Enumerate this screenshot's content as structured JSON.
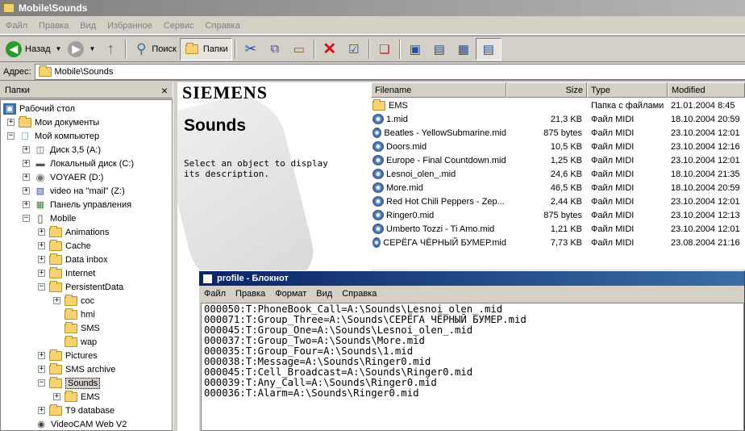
{
  "window": {
    "title": "Mobile\\Sounds"
  },
  "menu": [
    "Файл",
    "Правка",
    "Вид",
    "Избранное",
    "Сервис",
    "Справка"
  ],
  "toolbar": {
    "back_label": "Назад",
    "search_label": "Поиск",
    "folders_label": "Папки"
  },
  "address": {
    "label": "Адрес:",
    "value": "Mobile\\Sounds"
  },
  "folders_pane": {
    "title": "Папки",
    "close": "×",
    "tree": [
      {
        "label": "Рабочий стол"
      },
      {
        "label": "Мои документы"
      },
      {
        "label": "Мой компьютер"
      },
      {
        "label": "Диск 3,5 (A:)"
      },
      {
        "label": "Локальный диск (C:)"
      },
      {
        "label": "VOYAER (D:)"
      },
      {
        "label": "video на \"mail\" (Z:)"
      },
      {
        "label": "Панель управления"
      },
      {
        "label": "Mobile"
      },
      {
        "label": "Animations"
      },
      {
        "label": "Cache"
      },
      {
        "label": "Data inbox"
      },
      {
        "label": "Internet"
      },
      {
        "label": "PersistentData"
      },
      {
        "label": "coc"
      },
      {
        "label": "hmi"
      },
      {
        "label": "SMS"
      },
      {
        "label": "wap"
      },
      {
        "label": "Pictures"
      },
      {
        "label": "SMS archive"
      },
      {
        "label": "Sounds"
      },
      {
        "label": "EMS"
      },
      {
        "label": "T9 database"
      },
      {
        "label": "VideoCAM Web V2"
      }
    ]
  },
  "info_pane": {
    "brand": "SIEMENS",
    "title": "Sounds",
    "text": "Select an object to display its description."
  },
  "file_list": {
    "columns": [
      "Filename",
      "Size",
      "Type",
      "Modified"
    ],
    "rows": [
      {
        "name": "EMS",
        "size": "",
        "type": "Папка с файлами",
        "modified": "21.01.2004 8:45"
      },
      {
        "name": "1.mid",
        "size": "21,3 KB",
        "type": "Файл MIDI",
        "modified": "18.10.2004 20:59"
      },
      {
        "name": "Beatles - YellowSubmarine.mid",
        "size": "875 bytes",
        "type": "Файл MIDI",
        "modified": "23.10.2004 12:01"
      },
      {
        "name": "Doors.mid",
        "size": "10,5 KB",
        "type": "Файл MIDI",
        "modified": "23.10.2004 12:16"
      },
      {
        "name": "Europe - Final Countdown.mid",
        "size": "1,25 KB",
        "type": "Файл MIDI",
        "modified": "23.10.2004 12:01"
      },
      {
        "name": "Lesnoi_olen_.mid",
        "size": "24,6 KB",
        "type": "Файл MIDI",
        "modified": "18.10.2004 21:35"
      },
      {
        "name": "More.mid",
        "size": "46,5 KB",
        "type": "Файл MIDI",
        "modified": "18.10.2004 20:59"
      },
      {
        "name": "Red Hot Chili Peppers - Zep...",
        "size": "2,44 KB",
        "type": "Файл MIDI",
        "modified": "23.10.2004 12:01"
      },
      {
        "name": "Ringer0.mid",
        "size": "875 bytes",
        "type": "Файл MIDI",
        "modified": "23.10.2004 12:13"
      },
      {
        "name": "Umberto Tozzi - Ti Amo.mid",
        "size": "1,21 KB",
        "type": "Файл MIDI",
        "modified": "23.10.2004 12:01"
      },
      {
        "name": "СЕРЁГА ЧЁРНЫЙ БУМЕР.mid",
        "size": "7,73 KB",
        "type": "Файл MIDI",
        "modified": "23.08.2004 21:16"
      }
    ]
  },
  "notepad": {
    "title": "profile - Блокнот",
    "menu": [
      "Файл",
      "Правка",
      "Формат",
      "Вид",
      "Справка"
    ],
    "lines": [
      "000050:T:PhoneBook_Call=A:\\Sounds\\Lesnoi_olen_.mid",
      "000071:T:Group_Three=A:\\Sounds\\СЕРЁГА ЧЁРНЫЙ БУМЕР.mid",
      "000045:T:Group_One=A:\\Sounds\\Lesnoi_olen_.mid",
      "000037:T:Group_Two=A:\\Sounds\\More.mid",
      "000035:T:Group_Four=A:\\Sounds\\1.mid",
      "000038:T:Message=A:\\Sounds\\Ringer0.mid",
      "000045:T:Cell_Broadcast=A:\\Sounds\\Ringer0.mid",
      "000039:T:Any_Call=A:\\Sounds\\Ringer0.mid",
      "000036:T:Alarm=A:\\Sounds\\Ringer0.mid"
    ]
  }
}
